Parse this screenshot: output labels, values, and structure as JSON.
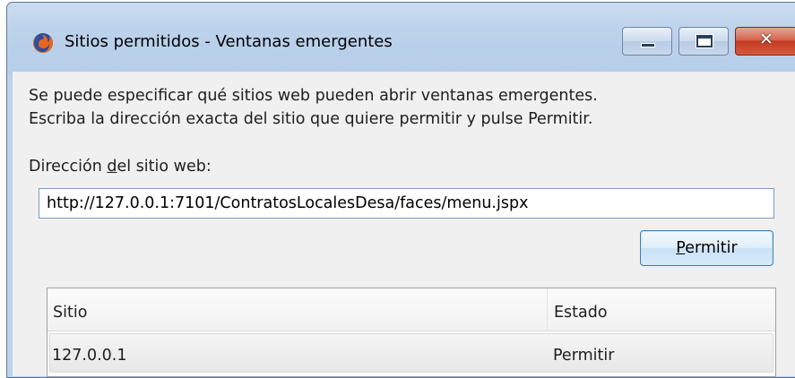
{
  "window": {
    "title": "Sitios permitidos - Ventanas emergentes",
    "app_icon": "firefox-icon",
    "controls": {
      "minimize": "minimize-icon",
      "maximize": "maximize-icon",
      "close": "close-icon",
      "close_glyph": "✕"
    }
  },
  "description": {
    "line1": "Se puede especificar qué sitios web pueden abrir ventanas emergentes.",
    "line2": "Escriba la dirección exacta del sitio que quiere permitir y pulse Permitir."
  },
  "address": {
    "label_before": "Dirección ",
    "label_mnemonic": "d",
    "label_after": "el sitio web:",
    "value": "http://127.0.0.1:7101/ContratosLocalesDesa/faces/menu.jspx"
  },
  "allow_button": {
    "mnemonic": "P",
    "rest": "ermitir"
  },
  "table": {
    "columns": [
      "Sitio",
      "Estado"
    ],
    "rows": [
      {
        "site": "127.0.0.1",
        "status": "Permitir"
      }
    ]
  },
  "colors": {
    "frame": "#bcd2eb",
    "client": "#f0f0f0",
    "close_button": "#c33a22",
    "input_border": "#7a9cc8"
  }
}
